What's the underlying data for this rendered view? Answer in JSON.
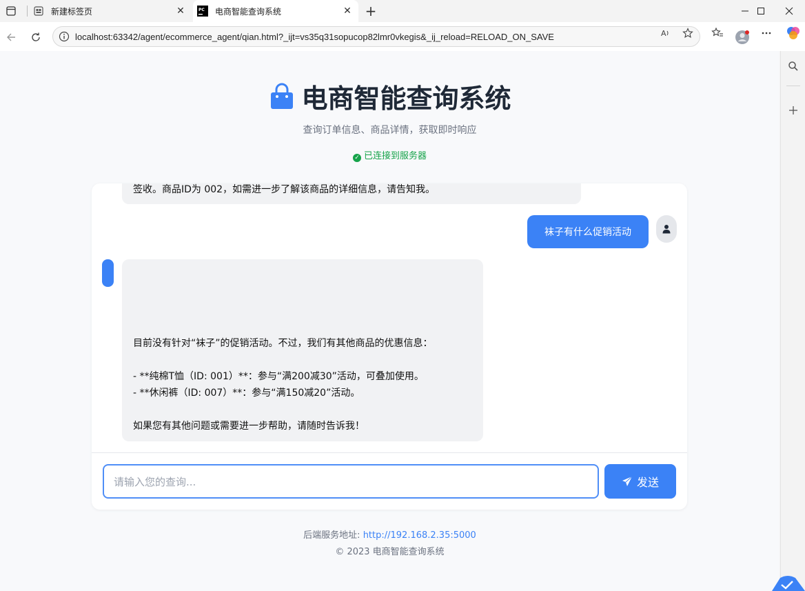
{
  "browser": {
    "tabs": [
      {
        "title": "新建标签页",
        "active": false
      },
      {
        "title": "电商智能查询系统",
        "active": true
      }
    ],
    "url": "localhost:63342/agent/ecommerce_agent/qian.html?_ijt=vs35q31sopucop82lmr0vkegis&_ij_reload=RELOAD_ON_SAVE",
    "window_controls": {
      "minimize": "—",
      "maximize": "☐",
      "close": "✕"
    },
    "new_tab": "+"
  },
  "header": {
    "title": "电商智能查询系统",
    "subtitle": "查询订单信息、商品详情，获取即时响应",
    "status": "已连接到服务器"
  },
  "chat": {
    "prev_message_tail": "签收。商品ID为 002，如需进一步了解该商品的详细信息，请告知我。",
    "user_message": "袜子有什么促销活动",
    "bot_lines": [
      "目前没有针对“袜子”的促销活动。不过，我们有其他商品的优惠信息：",
      "",
      "- **纯棉T恤（ID: 001）**：参与“满200减30”活动，可叠加使用。",
      "- **休闲裤（ID: 007）**：参与“满150减20”活动。",
      "",
      "如果您有其他问题或需要进一步帮助，请随时告诉我！"
    ]
  },
  "input": {
    "placeholder": "请输入您的查询..."
  },
  "send_label": "发送",
  "footer": {
    "backend_label": "后端服务地址: ",
    "backend_url": "http://192.168.2.35:5000",
    "copyright": "© 2023 电商智能查询系统"
  },
  "colors": {
    "accent": "#3b82f6",
    "status_green": "#16a34a",
    "title": "#1f2937"
  }
}
